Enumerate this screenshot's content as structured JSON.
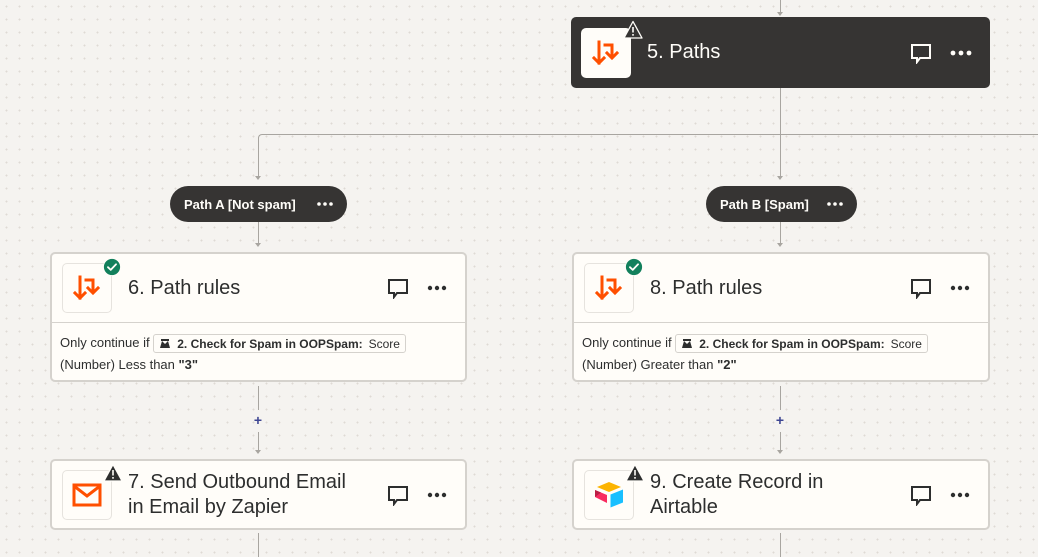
{
  "steps": {
    "paths": {
      "number_title": "5. Paths",
      "status": "warning",
      "icon": "paths-icon"
    },
    "path_a": {
      "label": "Path A [Not spam]",
      "rule_step": {
        "number_title": "6. Path rules",
        "status": "success",
        "icon": "paths-icon",
        "rule_prefix": "Only continue if",
        "token_step": "2. Check for Spam in OOPSpam:",
        "token_field": "Score",
        "rule_suffix": "(Number) Less than",
        "rule_value": "\"3\""
      },
      "action_step": {
        "title_line1": "7. Send Outbound Email",
        "title_line2": "in Email by Zapier",
        "status": "warning",
        "icon": "email-icon"
      }
    },
    "path_b": {
      "label": "Path B [Spam]",
      "rule_step": {
        "number_title": "8. Path rules",
        "status": "success",
        "icon": "paths-icon",
        "rule_prefix": "Only continue if",
        "token_step": "2. Check for Spam in OOPSpam:",
        "token_field": "Score",
        "rule_suffix": "(Number) Greater than",
        "rule_value": "\"2\""
      },
      "action_step": {
        "title_line1": "9. Create Record in",
        "title_line2": "Airtable",
        "status": "warning",
        "icon": "airtable-icon"
      }
    }
  },
  "connector": {
    "add_label": "+"
  },
  "colors": {
    "dark_card": "#363433",
    "zapier_orange": "#ff4f00",
    "success_green": "#12805c",
    "plus_blue": "#3d4592"
  }
}
